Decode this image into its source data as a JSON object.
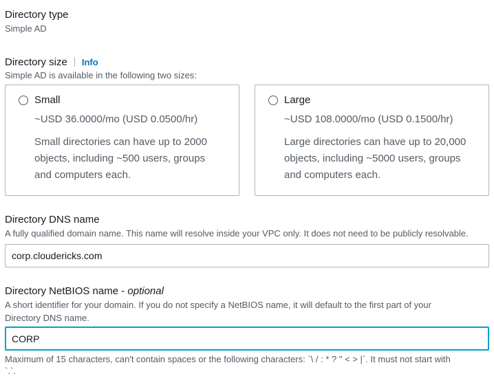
{
  "directory_type": {
    "label": "Directory type",
    "value": "Simple AD"
  },
  "directory_size": {
    "label": "Directory size",
    "info_link": "Info",
    "description": "Simple AD is available in the following two sizes:",
    "options": [
      {
        "title": "Small",
        "price": "~USD 36.0000/mo (USD 0.0500/hr)",
        "desc_lines": [
          "Small directories can have up to 2000",
          "objects, including ~500 users, groups",
          "and computers each."
        ],
        "selected": false
      },
      {
        "title": "Large",
        "price": "~USD 108.0000/mo (USD 0.1500/hr)",
        "desc_lines": [
          "Large directories can have up to 20,000",
          "objects, including ~5000 users, groups",
          "and computers each."
        ],
        "selected": false
      }
    ]
  },
  "dns_name": {
    "label": "Directory DNS name",
    "description": "A fully qualified domain name. This name will resolve inside your VPC only. It does not need to be publicly resolvable.",
    "value": "corp.cloudericks.com"
  },
  "netbios_name": {
    "label": "Directory NetBIOS name - ",
    "label_optional": "optional",
    "description_line1": "A short identifier for your domain. If you do not specify a NetBIOS name, it will default to the first part of your",
    "description_line2": "Directory DNS name.",
    "value": "CORP",
    "constraint_line1": "Maximum of 15 characters, can't contain spaces or the following characters: `\\ / : * ? \" < > |`. It must not start with",
    "constraint_line2": "`.`."
  },
  "colors": {
    "link": "#0073bb",
    "focus_border": "#00a1c9",
    "border": "#aab7b8",
    "secondary_text": "#545b64"
  }
}
